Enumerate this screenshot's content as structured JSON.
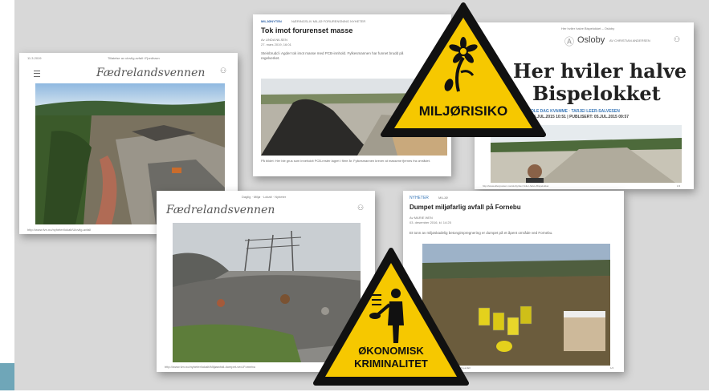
{
  "articles": {
    "fvn1": {
      "date": "11.3.2019",
      "topline": "Tillatelse av ulovlig avfall i Fjordhavn",
      "masthead": "Fædrelandsvennen",
      "footer_url": "http://www.fvn.no/nyheter/lokalt/Ulovlig-avfall",
      "page": "1/4"
    },
    "tok": {
      "section": "MILJØNYTEN",
      "crumbs": "NÆRINGSLIV   MILJØ   FORURENSNING   NYHETER",
      "headline": "Tok imot forurenset masse",
      "byline": "Av LINDA NILSEN",
      "date": "27. mars 2019, 16:01",
      "lead": "Steinbrudd i Agder tok imot masse med PCB-innhold. Fylkesmannen har funnet brudd på regelverket.",
      "caption": "På bildet: Her ble grus som inneholdt PCB-rester lagret i flere år. Fylkesmannen krever at massene fjernes fra området."
    },
    "oslo": {
      "topline": "Her hviler halve Bispelokket – Osloby",
      "logo": "Osloby",
      "byline_top": "AV CHRISTIAN ANDERSEN",
      "headline_line1": "Her hviler halve",
      "headline_line2": "Bispelokket",
      "authors": "OLE DAG KVAMME · TARJEI LEER-SALVESEN",
      "dates": "PUBLISERT: 05.JUL.2015 10:51 | PUBLISERT: 05.JUL.2015 09:57",
      "footer_url": "http://www.aftenposten.no/osloby/Her-hviler-halve-Bispelokket",
      "page": "1/3"
    },
    "fvn2": {
      "crumbs": "Daglig · Miljø · Lokalt · Nyheter",
      "masthead": "Fædrelandsvennen",
      "footer_url": "http://www.fvn.no/nyheter/lokalt/Miljøavfall-dumpet-ved-Fornebu",
      "page": "1/4"
    },
    "dumpet": {
      "section": "NYHETER",
      "section_sub": "MILJØ",
      "headline": "Dumpet miljøfarlig avfall på Fornebu",
      "byline": "Av MARIE WEN",
      "date": "03. desember 2016, kl. 14:25",
      "lead": "Et tonn av miljøskadelig betongimpregnering er dumpet på et åpent område ved Fornebu.",
      "footer_url": "http://www.budstikka.no/nyheter/Dumpet-miljøfarlig-avfall",
      "page": "1/4"
    }
  },
  "signs": {
    "miljo": {
      "label": "MILJØRISIKO",
      "icon": "wilted-flower-icon"
    },
    "okonomisk": {
      "line1": "ØKONOMISK",
      "line2": "KRIMINALITET",
      "icon": "person-with-money-icon"
    }
  },
  "colors": {
    "sign_yellow": "#f6c800",
    "sign_border": "#111111",
    "background": "#d8d8d8",
    "accent_strip": "#6fa6b8"
  }
}
